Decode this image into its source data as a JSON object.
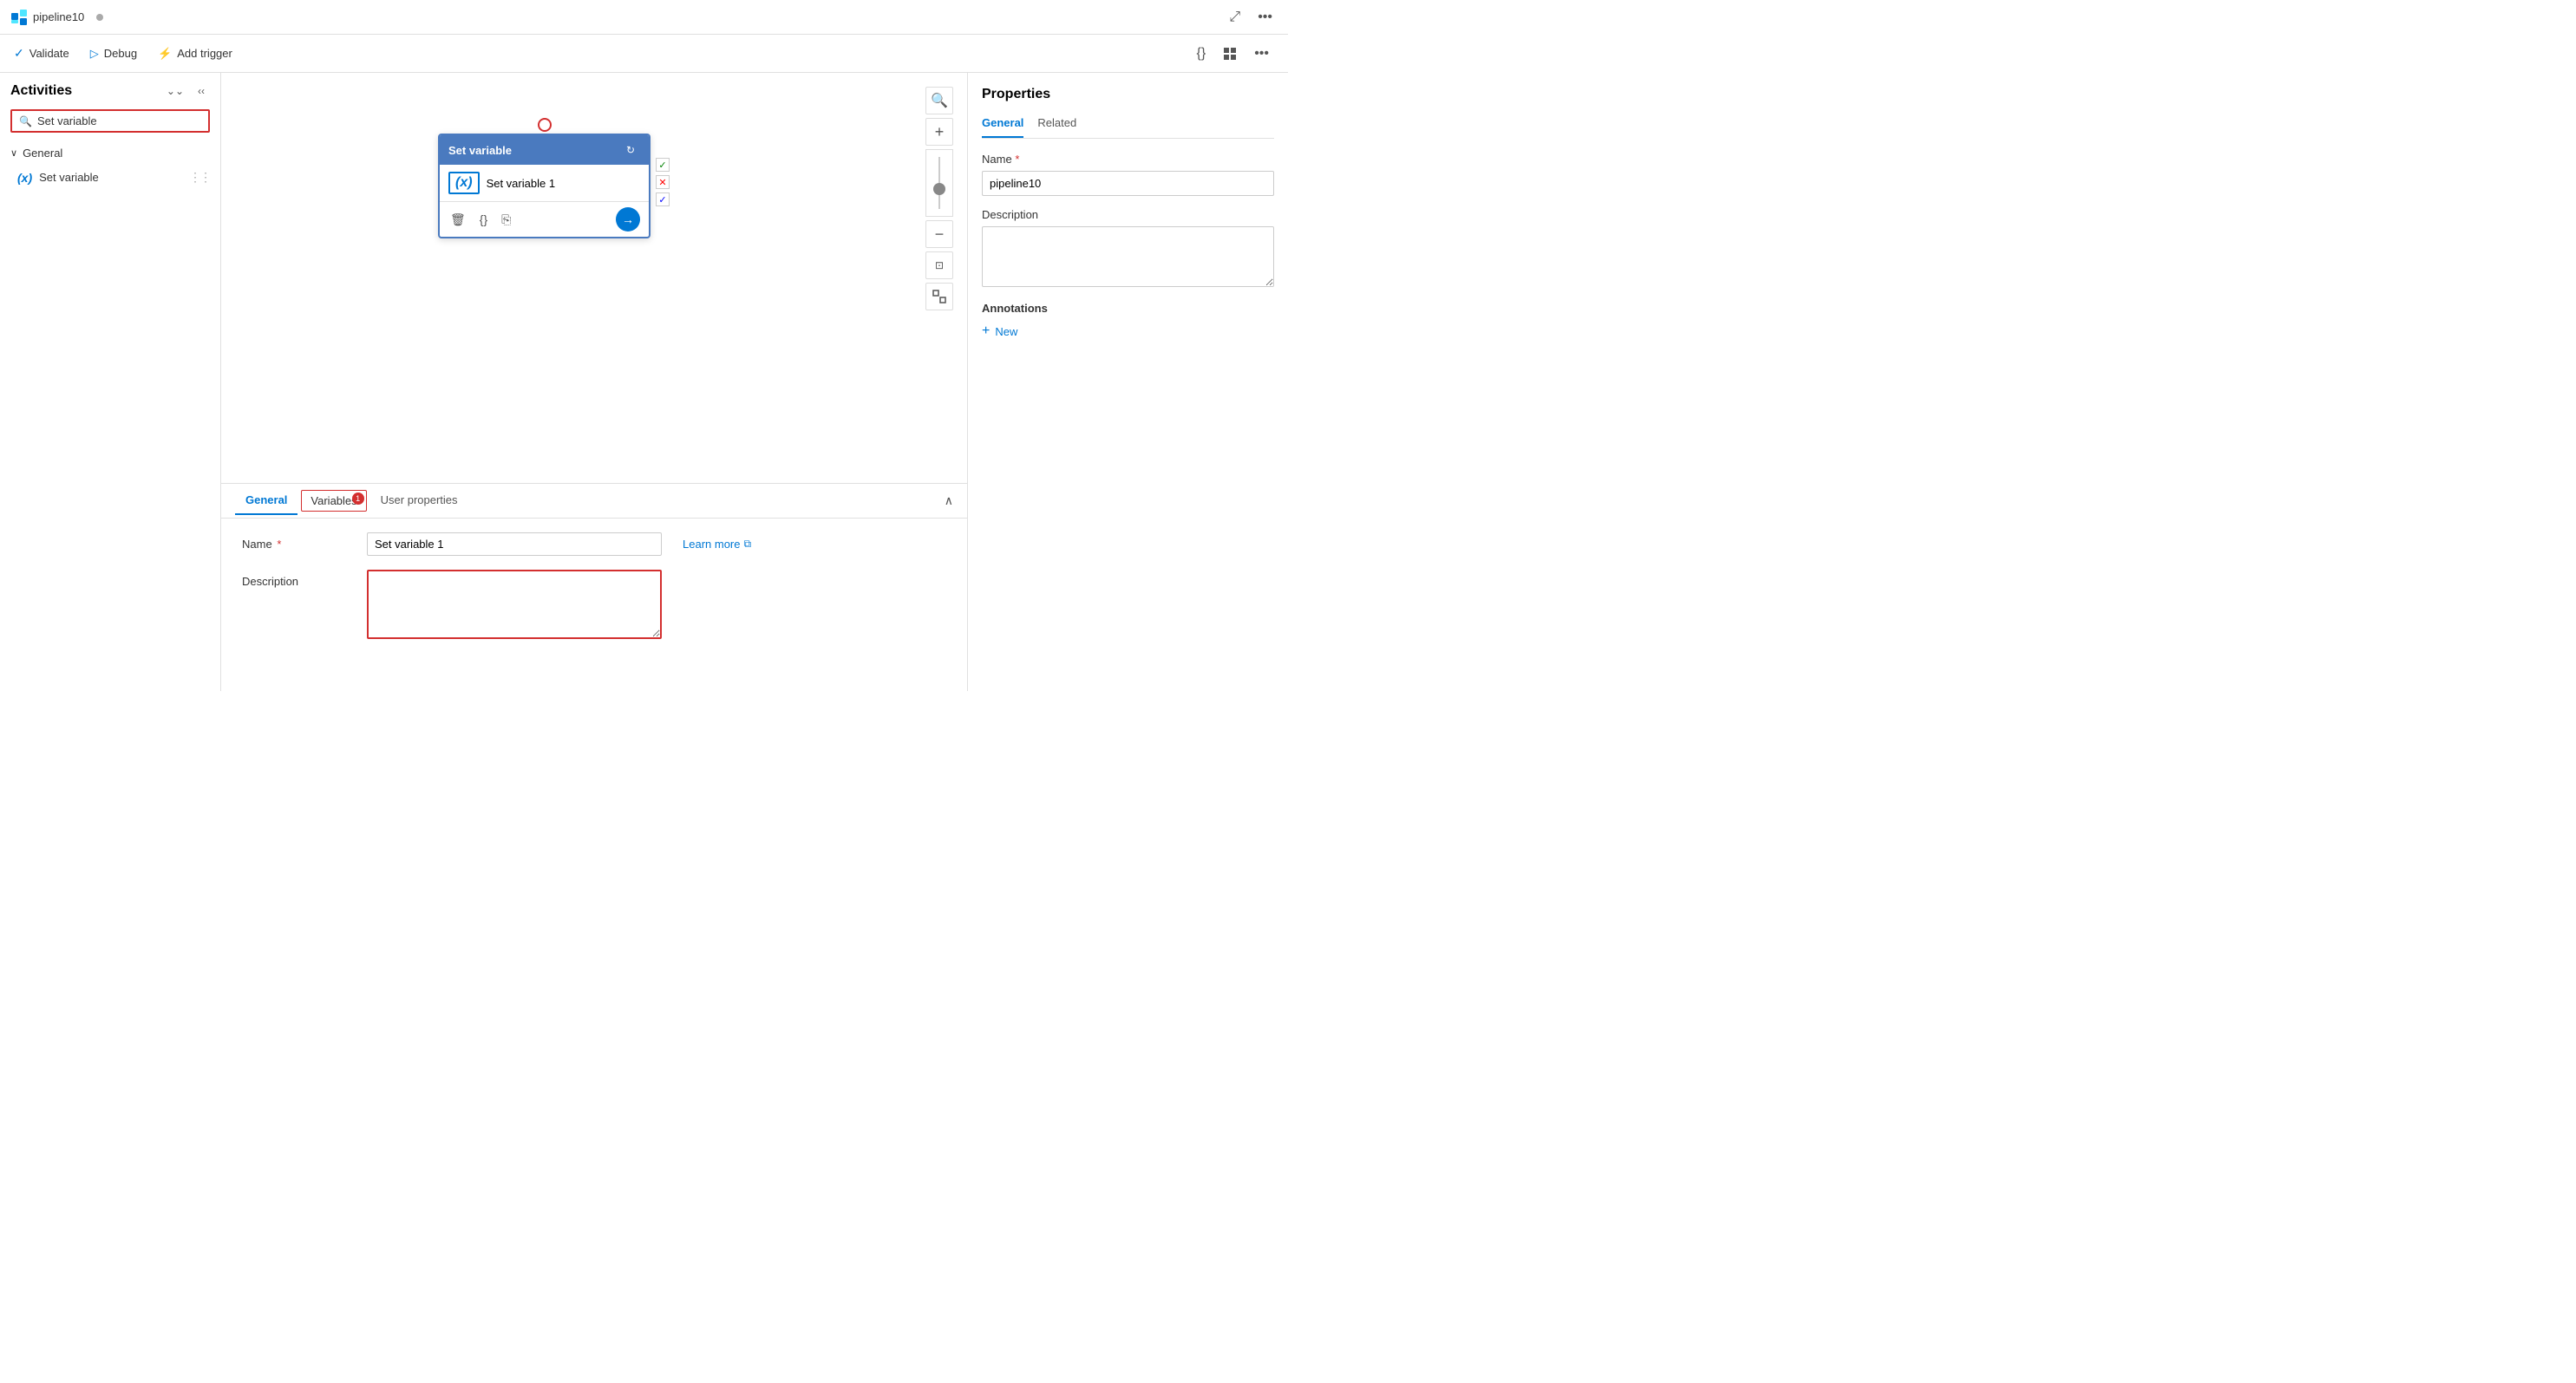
{
  "topbar": {
    "title": "pipeline10",
    "dot_indicator": true
  },
  "toolbar": {
    "validate_label": "Validate",
    "debug_label": "Debug",
    "add_trigger_label": "Add trigger"
  },
  "left_panel": {
    "title": "Activities",
    "search_placeholder": "Set variable",
    "search_value": "Set variable",
    "section_general": "General",
    "activity_item": "Set variable",
    "expand_icon": "▾",
    "collapse_icon": "‹‹"
  },
  "canvas": {
    "node": {
      "header": "Set variable",
      "body_label": "Set variable 1",
      "icon_label": "(x)"
    }
  },
  "bottom_panel": {
    "tabs": [
      {
        "id": "general",
        "label": "General",
        "badge": null,
        "active": true
      },
      {
        "id": "variables",
        "label": "Variables",
        "badge": "1",
        "outlined": true
      },
      {
        "id": "user_properties",
        "label": "User properties",
        "badge": null
      }
    ],
    "form": {
      "name_label": "Name",
      "name_required": true,
      "name_value": "Set variable 1",
      "name_placeholder": "",
      "learn_more": "Learn more",
      "description_label": "Description",
      "description_value": "",
      "description_placeholder": ""
    }
  },
  "right_panel": {
    "title": "Properties",
    "tabs": [
      {
        "id": "general",
        "label": "General",
        "active": true
      },
      {
        "id": "related",
        "label": "Related"
      }
    ],
    "name_label": "Name",
    "name_required": true,
    "name_value": "pipeline10",
    "description_label": "Description",
    "description_value": "",
    "annotations_label": "Annotations",
    "new_annotation_label": "New"
  }
}
